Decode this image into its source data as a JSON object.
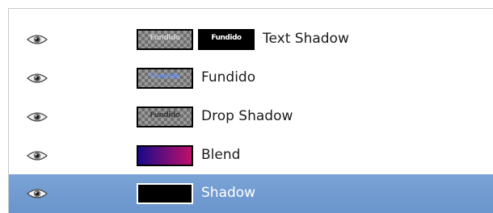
{
  "layers": [
    {
      "label": "Text Shadow",
      "visible": true,
      "selected": false,
      "thumbnails": [
        {
          "kind": "checker",
          "text": "Fundido",
          "text_color": "#d0d0d0"
        },
        {
          "kind": "solid",
          "fill": "#000000",
          "text": "Fundido",
          "text_color": "#ffffff"
        }
      ]
    },
    {
      "label": "Fundido",
      "visible": true,
      "selected": false,
      "thumbnails": [
        {
          "kind": "checker",
          "text": "Fundido",
          "text_color": "#6a8ee0"
        }
      ]
    },
    {
      "label": "Drop Shadow",
      "visible": true,
      "selected": false,
      "thumbnails": [
        {
          "kind": "checker",
          "text": "Fundido",
          "text_color": "#3a3a3a"
        }
      ]
    },
    {
      "label": "Blend",
      "visible": true,
      "selected": false,
      "thumbnails": [
        {
          "kind": "gradient",
          "from": "#1a0a8a",
          "to": "#c0106a"
        }
      ]
    },
    {
      "label": "Shadow",
      "visible": true,
      "selected": true,
      "thumbnails": [
        {
          "kind": "solid",
          "fill": "#000000",
          "frame": "#ffffff"
        }
      ]
    }
  ],
  "colors": {
    "selection": "#6f9bd1",
    "text": "#1a1a1a",
    "selected_text": "#ffffff"
  },
  "icons": {
    "visibility": "eye-icon"
  }
}
